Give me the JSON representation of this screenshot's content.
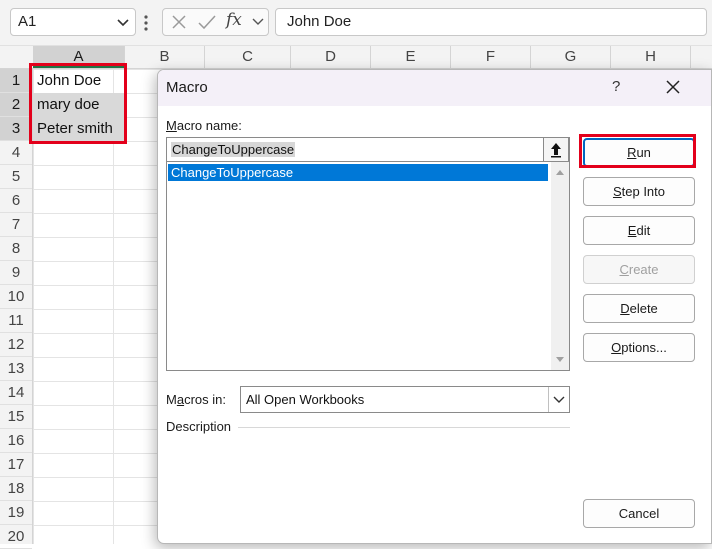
{
  "name_box": {
    "value": "A1"
  },
  "formula_bar": {
    "fx_label": "fx",
    "value": "John Doe"
  },
  "columns": [
    "A",
    "B",
    "C",
    "D",
    "E",
    "F",
    "G",
    "H"
  ],
  "rows": [
    "1",
    "2",
    "3",
    "4",
    "5",
    "6",
    "7",
    "8",
    "9",
    "10",
    "11",
    "12",
    "13",
    "14",
    "15",
    "16",
    "17",
    "18",
    "19",
    "20"
  ],
  "cells": {
    "A1": "John Doe",
    "A2": "mary doe",
    "A3": "Peter smith"
  },
  "dialog": {
    "title": "Macro",
    "help_label": "?",
    "macro_name_label_accel": "M",
    "macro_name_label_rest": "acro name:",
    "macro_name_value": "ChangeToUppercase",
    "macro_list": [
      "ChangeToUppercase"
    ],
    "macros_in_label_pre": "M",
    "macros_in_label_accel": "a",
    "macros_in_label_post": "cros in:",
    "macros_in_value": "All Open Workbooks",
    "description_label": "Description",
    "buttons": {
      "run": {
        "accel": "R",
        "rest": "un"
      },
      "step_into": {
        "accel": "S",
        "rest": "tep Into"
      },
      "edit": {
        "accel": "E",
        "rest": "dit"
      },
      "create": {
        "accel": "C",
        "rest": "reate"
      },
      "delete": {
        "accel": "D",
        "rest": "elete"
      },
      "options": {
        "accel": "O",
        "rest": "ptions..."
      },
      "cancel": {
        "label": "Cancel"
      }
    }
  },
  "colors": {
    "highlight_red": "#e3001b",
    "selection_blue": "#0078d7",
    "excel_green": "#217346"
  }
}
